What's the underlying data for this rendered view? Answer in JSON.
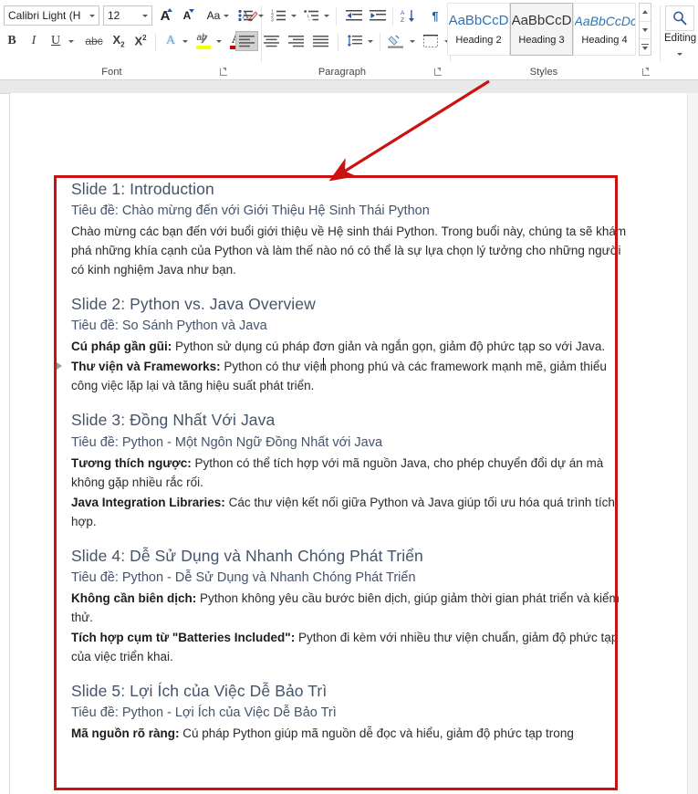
{
  "ribbon": {
    "font_group": {
      "label": "Font",
      "font_name": "Calibri Light (H",
      "font_size": "12",
      "grow_font": "A",
      "shrink_font": "A",
      "change_case": "Aa",
      "clear_formatting": "clear-formatting-icon",
      "bold": "B",
      "italic": "I",
      "underline": "U",
      "strikethrough": "abc",
      "subscript": "X2",
      "superscript": "X2",
      "text_effects": "A",
      "text_highlight": "ab",
      "font_color": "A"
    },
    "paragraph_group": {
      "label": "Paragraph",
      "bullets": "bullets-icon",
      "numbering": "numbering-icon",
      "multilevel_list": "multilevel-list-icon",
      "decrease_indent": "decrease-indent-icon",
      "increase_indent": "increase-indent-icon",
      "sort": "sort-icon",
      "show_marks": "¶",
      "align_left": "align-left-icon",
      "align_center": "align-center-icon",
      "align_right": "align-right-icon",
      "justify": "justify-icon",
      "line_spacing": "line-spacing-icon",
      "shading": "shading-icon",
      "borders": "borders-icon"
    },
    "styles_group": {
      "label": "Styles",
      "items": [
        {
          "preview": "AaBbCcD",
          "name": "Heading 2",
          "selected": false
        },
        {
          "preview": "AaBbCcD",
          "name": "Heading 3",
          "selected": true
        },
        {
          "preview": "AaBbCcDc",
          "name": "Heading 4",
          "selected": false
        }
      ],
      "scroll_up": "scroll-up-icon",
      "scroll_down": "scroll-down-icon",
      "more": "more-styles-icon"
    },
    "editing_group": {
      "label": "Editing",
      "find_icon": "search-icon",
      "dropdown": "chevron-down-icon"
    }
  },
  "annotation": {
    "box_color": "#CC1111",
    "arrow_color": "#CC1111",
    "arrow_from": "styles-gallery",
    "arrow_to": "document-headings"
  },
  "document": {
    "blocks": [
      {
        "heading": "Slide 1: Introduction",
        "subheading": "Tiêu đề: Chào mừng đến với Giới Thiệu Hệ Sinh Thái Python",
        "paragraphs": [
          {
            "bold": "",
            "text": "Chào mừng các bạn đến với buổi giới thiệu về Hệ sinh thái Python. Trong buổi này, chúng ta sẽ khám phá những khía cạnh của Python và làm thế nào nó có thể là sự lựa chọn lý tưởng cho những người có kinh nghiệm Java như bạn."
          }
        ]
      },
      {
        "heading": "Slide 2: Python vs. Java Overview",
        "subheading": "Tiêu đề: So Sánh Python và Java",
        "paragraphs": [
          {
            "bold": "Cú pháp gần gũi:",
            "text": " Python sử dụng cú pháp đơn giản và ngắn gọn, giảm độ phức tạp so với Java."
          },
          {
            "bold": "Thư viện và Frameworks:",
            "text": " Python có thư viện phong phú và các framework mạnh mẽ, giảm thiểu công việc lặp lại và tăng hiệu suất phát triển."
          }
        ]
      },
      {
        "heading": "Slide 3: Đồng Nhất Với Java",
        "subheading": "Tiêu đề: Python - Một Ngôn Ngữ Đồng Nhất với Java",
        "paragraphs": [
          {
            "bold": "Tương thích ngược:",
            "text": " Python có thể tích hợp với mã nguồn Java, cho phép chuyển đổi dự án mà không gặp nhiều rắc rối."
          },
          {
            "bold": "Java Integration Libraries:",
            "text": " Các thư viện kết nối giữa Python và Java giúp tối ưu hóa quá trình tích hợp."
          }
        ]
      },
      {
        "heading": "Slide 4: Dễ Sử Dụng và Nhanh Chóng Phát Triển",
        "subheading": "Tiêu đề: Python - Dễ Sử Dụng và Nhanh Chóng Phát Triển",
        "paragraphs": [
          {
            "bold": "Không cần biên dịch:",
            "text": " Python không yêu cầu bước biên dịch, giúp giảm thời gian phát triển và kiểm thử."
          },
          {
            "bold": "Tích hợp cụm từ \"Batteries Included\":",
            "text": " Python đi kèm với nhiều thư viện chuẩn, giảm độ phức tạp của việc triển khai."
          }
        ]
      },
      {
        "heading": "Slide 5: Lợi Ích của Việc Dễ Bảo Trì",
        "subheading": "Tiêu đề: Python - Lợi Ích của Việc Dễ Bảo Trì",
        "paragraphs": [
          {
            "bold": "Mã nguồn rõ ràng:",
            "text": " Cú pháp Python giúp mã nguồn dễ đọc và hiểu, giảm độ phức tạp trong"
          }
        ]
      }
    ]
  },
  "colors": {
    "heading": "#44546A",
    "body": "#2B2B2B",
    "annotation_red": "#CC1111",
    "ribbon_bg": "#FFFFFF",
    "icon_blue": "#2B579A"
  }
}
